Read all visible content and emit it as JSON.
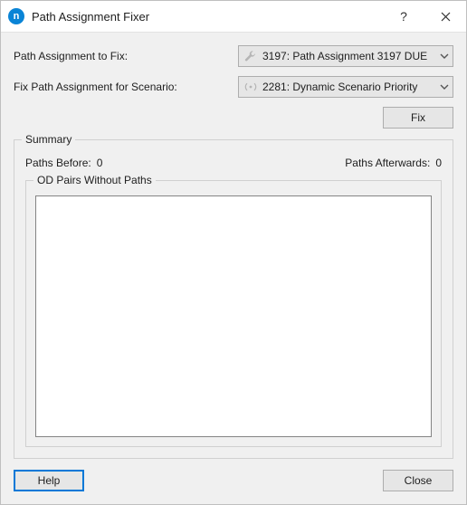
{
  "titlebar": {
    "icon_letter": "n",
    "title": "Path Assignment Fixer"
  },
  "form": {
    "path_assignment_label": "Path Assignment to Fix:",
    "path_assignment_value": "3197: Path Assignment 3197 DUE",
    "scenario_label": "Fix Path Assignment for Scenario:",
    "scenario_value": "2281: Dynamic Scenario Priority",
    "fix_button": "Fix"
  },
  "summary": {
    "legend": "Summary",
    "paths_before_label": "Paths Before:",
    "paths_before_value": "0",
    "paths_after_label": "Paths Afterwards:",
    "paths_after_value": "0",
    "od_legend": "OD Pairs Without Paths"
  },
  "footer": {
    "help": "Help",
    "close": "Close"
  }
}
